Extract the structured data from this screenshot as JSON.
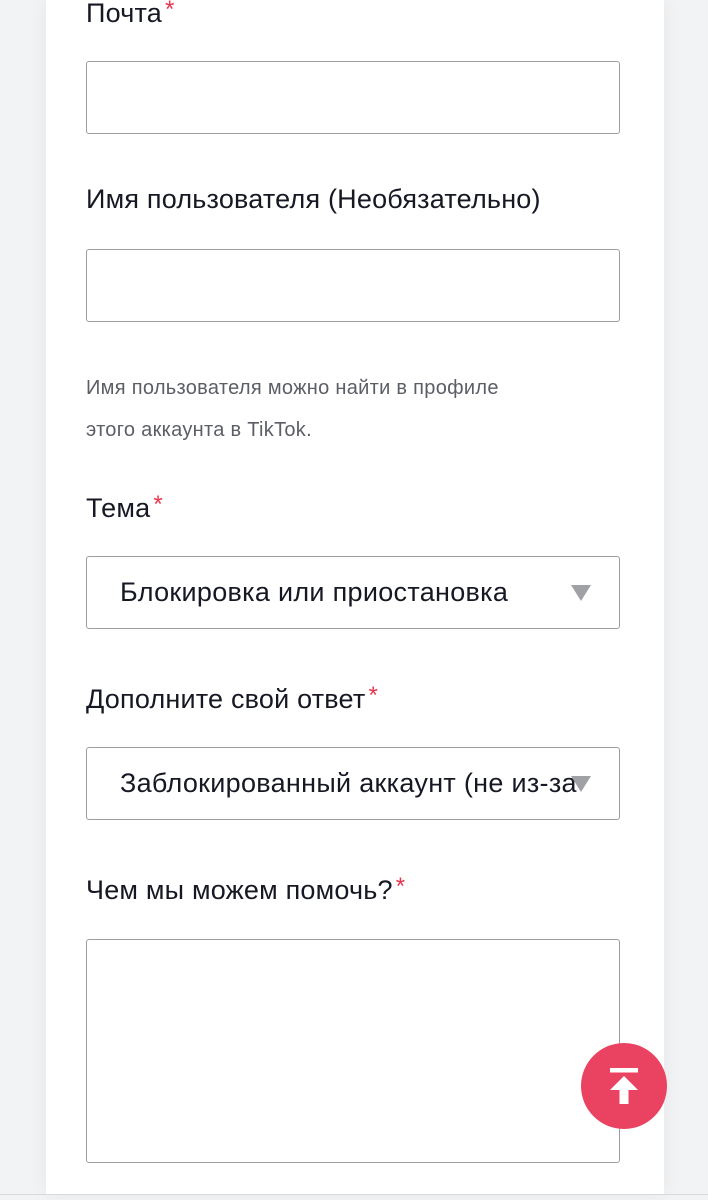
{
  "form": {
    "email": {
      "label": "Почта",
      "required_mark": "*",
      "value": ""
    },
    "username": {
      "label": "Имя пользователя (Необязательно)",
      "value": "",
      "help_line1": "Имя пользователя можно найти в профиле",
      "help_line2": "этого аккаунта в TikTok."
    },
    "topic": {
      "label": "Тема",
      "required_mark": "*",
      "selected": "Блокировка или приостановка"
    },
    "detail": {
      "label": "Дополните свой ответ",
      "required_mark": "*",
      "selected": "Заблокированный аккаунт (не из-за"
    },
    "help_request": {
      "label": "Чем мы можем помочь?",
      "required_mark": "*",
      "value": ""
    }
  },
  "scroll_top_button": {
    "icon": "arrow-up-to-top-icon"
  },
  "colors": {
    "accent": "#ea4361",
    "required": "#e8344d",
    "text": "#161823",
    "muted": "#5c5e66",
    "border": "#9c9ea3"
  }
}
